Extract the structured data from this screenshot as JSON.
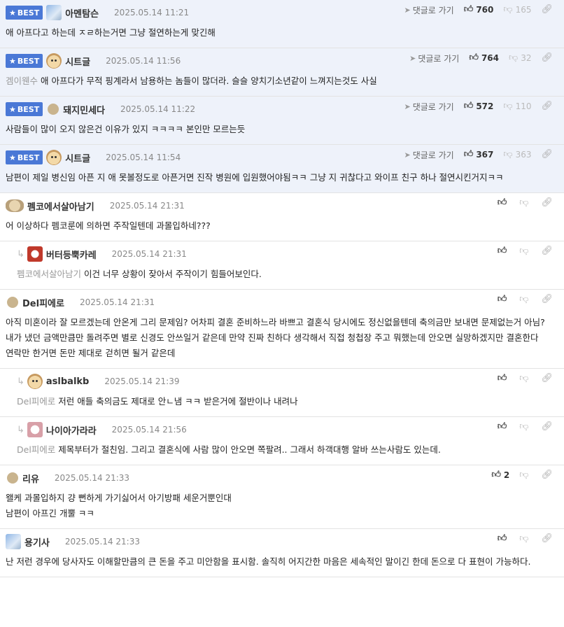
{
  "labels": {
    "best": "BEST",
    "goto": "댓글로 가기"
  },
  "comments": [
    {
      "best": true,
      "avatar": "avatar-blue",
      "nick": "아멘탐슨",
      "date": "2025.05.14 11:21",
      "likes": "760",
      "dislikes": "165",
      "mention": "",
      "text": "애 아프다고 하는데 ㅈㄹ하는거면 그냥 절연하는게 맞긴해"
    },
    {
      "best": true,
      "avatar": "avatar-dog",
      "nick": "시트글",
      "date": "2025.05.14 11:56",
      "likes": "764",
      "dislikes": "32",
      "mention": "겜이웬수",
      "text": "애 아프다가 무적 핑계라서 남용하는 놈들이 많더라. 슬슬 양치기소년같이 느껴지는것도 사실"
    },
    {
      "best": true,
      "avatar": "avatar-dot",
      "nick": "돼지민세다",
      "date": "2025.05.14 11:22",
      "likes": "572",
      "dislikes": "110",
      "mention": "",
      "text": "사람들이 많이 오지 않은건 이유가 있지 ㅋㅋㅋㅋ 본인만 모르는듯"
    },
    {
      "best": true,
      "avatar": "avatar-dog",
      "nick": "시트글",
      "date": "2025.05.14 11:54",
      "likes": "367",
      "dislikes": "363",
      "mention": "",
      "text": "남편이 제일 병신임 아픈 지 애 못볼정도로 아픈거면 진작 병원에 입원했어야됨ㅋㅋ 그냥 지 귀찮다고 와이프 친구 하나 절연시킨거지ㅋㅋ"
    },
    {
      "best": false,
      "reply": false,
      "avatar": "avatar-rock",
      "nick": "펨코에서살아남기",
      "date": "2025.05.14 21:31",
      "likes": "",
      "mention": "",
      "text": "어 이상하다 펨코룬에 의하면 주작일텐데 과몰입하네???"
    },
    {
      "best": false,
      "reply": true,
      "avatar": "avatar-red",
      "nick": "버터등뿍카레",
      "date": "2025.05.14 21:31",
      "likes": "",
      "mention": "펨코에서살아남기",
      "text": "이건 너무 상황이 잦아서 주작이기 힘들어보인다."
    },
    {
      "best": false,
      "reply": false,
      "avatar": "avatar-dot",
      "nick": "Del피에로",
      "date": "2025.05.14 21:31",
      "likes": "",
      "mention": "",
      "text": "아직 미혼이라 잘 모르겠는데 안온게 그리 문제임? 어차피 결혼 준비하느라 바쁘고 결혼식 당시에도 정신없을텐데 축의금만 보내면 문제없는거 아님? 내가 냈던 금액만큼만 돌려주면 별로 신경도 안쓰일거 같은데 만약 진짜 친하다 생각해서 직접 청첩장 주고 뭐했는데 안오면 실망하겠지만 결혼한다 연락만 한거면 돈만 제대로 걷히면 될거 같은데"
    },
    {
      "best": false,
      "reply": true,
      "avatar": "avatar-dog",
      "nick": "aslbalkb",
      "date": "2025.05.14 21:39",
      "likes": "",
      "mention": "Del피에로",
      "text": "저런 애들 축의금도 제대로 안ㄴ냄 ㅋㅋ 받은거에 절반이나 내려나"
    },
    {
      "best": false,
      "reply": true,
      "avatar": "avatar-pink",
      "nick": "나이아가라라",
      "date": "2025.05.14 21:56",
      "likes": "",
      "mention": "Del피에로",
      "text": "제목부터가 절친임. 그리고 결혼식에 사람 많이 안오면 쪽팔려.. 그래서 하객대행 알바 쓰는사람도 있는데."
    },
    {
      "best": false,
      "reply": false,
      "avatar": "avatar-dot",
      "nick": "리유",
      "date": "2025.05.14 21:33",
      "likes": "2",
      "mention": "",
      "text": "왤케 과몰입하지 걍 뻔하게 가기싫어서 아기방패 세운거뿐인대\n남편이 아프긴 개뿔 ㅋㅋ"
    },
    {
      "best": false,
      "reply": false,
      "avatar": "avatar-blue",
      "nick": "용기사",
      "date": "2025.05.14 21:33",
      "likes": "",
      "mention": "",
      "text": "난 저런 경우에 당사자도 이해할만큼의 큰 돈을 주고 미안함을 표시함. 솔직히 어지간한 마음은 세속적인 말이긴 한데 돈으로 다 표현이 가능하다."
    }
  ]
}
